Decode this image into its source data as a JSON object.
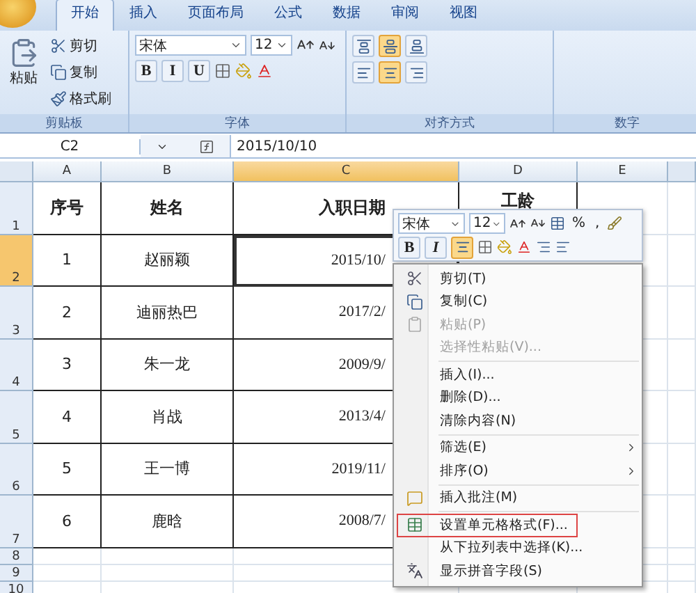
{
  "tabs": [
    {
      "label": "开始",
      "selected": true
    },
    {
      "label": "插入",
      "selected": false
    },
    {
      "label": "页面布局",
      "selected": false
    },
    {
      "label": "公式",
      "selected": false
    },
    {
      "label": "数据",
      "selected": false
    },
    {
      "label": "审阅",
      "selected": false
    },
    {
      "label": "视图",
      "selected": false
    }
  ],
  "ribbon": {
    "clipboard": {
      "label": "剪贴板",
      "paste": "粘贴",
      "items": [
        {
          "kind": "cut",
          "label": "剪切"
        },
        {
          "kind": "copy",
          "label": "复制"
        },
        {
          "kind": "painter",
          "label": "格式刷"
        }
      ]
    },
    "font": {
      "label": "字体",
      "font_name": "宋体",
      "font_size": "12",
      "styles": [
        "B",
        "I",
        "U"
      ]
    },
    "alignment": {
      "label": "对齐方式",
      "buttons": [
        {
          "kind": "top",
          "pressed": false
        },
        {
          "kind": "middle",
          "pressed": true
        },
        {
          "kind": "bottom",
          "pressed": false
        },
        {
          "kind": "left",
          "pressed": false
        },
        {
          "kind": "center",
          "pressed": true
        },
        {
          "kind": "right",
          "pressed": false
        }
      ]
    },
    "number": {
      "label": "数字"
    }
  },
  "formula_bar": {
    "name_box": "C2",
    "value": "2015/10/10"
  },
  "columns": [
    {
      "label": "A",
      "selected": false
    },
    {
      "label": "B",
      "selected": false
    },
    {
      "label": "C",
      "selected": true
    },
    {
      "label": "D",
      "selected": false
    },
    {
      "label": "E",
      "selected": false
    }
  ],
  "rows": [
    {
      "header": "1",
      "selected": false,
      "cells": [
        {
          "text": "序号",
          "active": false
        },
        {
          "text": "姓名",
          "active": false
        },
        {
          "text": "入职日期",
          "active": false
        },
        {
          "text": "工龄",
          "active": false
        }
      ]
    },
    {
      "header": "2",
      "selected": true,
      "cells": [
        {
          "text": "1",
          "active": false
        },
        {
          "text": "赵丽颖",
          "active": false
        },
        {
          "text": "2015/10/",
          "active": true
        }
      ]
    },
    {
      "header": "3",
      "selected": false,
      "cells": [
        {
          "text": "2",
          "active": false
        },
        {
          "text": "迪丽热巴",
          "active": false
        },
        {
          "text": "2017/2/",
          "active": false
        }
      ]
    },
    {
      "header": "4",
      "selected": false,
      "cells": [
        {
          "text": "3",
          "active": false
        },
        {
          "text": "朱一龙",
          "active": false
        },
        {
          "text": "2009/9/",
          "active": false
        }
      ]
    },
    {
      "header": "5",
      "selected": false,
      "cells": [
        {
          "text": "4",
          "active": false
        },
        {
          "text": "肖战",
          "active": false
        },
        {
          "text": "2013/4/",
          "active": false
        }
      ]
    },
    {
      "header": "6",
      "selected": false,
      "cells": [
        {
          "text": "5",
          "active": false
        },
        {
          "text": "王一博",
          "active": false
        },
        {
          "text": "2019/11/",
          "active": false
        }
      ]
    },
    {
      "header": "7",
      "selected": false,
      "cells": [
        {
          "text": "6",
          "active": false
        },
        {
          "text": "鹿晗",
          "active": false
        },
        {
          "text": "2008/7/",
          "active": false
        }
      ]
    },
    {
      "header": "8",
      "selected": false,
      "cells": []
    },
    {
      "header": "9",
      "selected": false,
      "cells": []
    },
    {
      "header": "10",
      "selected": false,
      "cells": []
    }
  ],
  "mini_toolbar": {
    "font_name": "宋体",
    "font_size": "12",
    "percent": "%",
    "comma": ",",
    "bold": "B",
    "italic": "I",
    "center_pressed": true
  },
  "context_menu": [
    {
      "kind": "cut",
      "label": "剪切(T)",
      "disabled": false,
      "submenu": false,
      "highlighted": false
    },
    {
      "kind": "copy",
      "label": "复制(C)",
      "disabled": false,
      "submenu": false,
      "highlighted": false
    },
    {
      "kind": "paste",
      "label": "粘贴(P)",
      "disabled": true,
      "submenu": false,
      "highlighted": false
    },
    {
      "kind": "plain",
      "label": "选择性粘贴(V)...",
      "disabled": true,
      "submenu": false,
      "highlighted": false
    },
    {
      "kind": "separator"
    },
    {
      "kind": "plain",
      "label": "插入(I)...",
      "disabled": false,
      "submenu": false,
      "highlighted": false
    },
    {
      "kind": "plain",
      "label": "删除(D)...",
      "disabled": false,
      "submenu": false,
      "highlighted": false
    },
    {
      "kind": "plain",
      "label": "清除内容(N)",
      "disabled": false,
      "submenu": false,
      "highlighted": false
    },
    {
      "kind": "separator"
    },
    {
      "kind": "plain",
      "label": "筛选(E)",
      "disabled": false,
      "submenu": true,
      "highlighted": false
    },
    {
      "kind": "plain",
      "label": "排序(O)",
      "disabled": false,
      "submenu": true,
      "highlighted": false
    },
    {
      "kind": "separator"
    },
    {
      "kind": "comment",
      "label": "插入批注(M)",
      "disabled": false,
      "submenu": false,
      "highlighted": false
    },
    {
      "kind": "separator"
    },
    {
      "kind": "format",
      "label": "设置单元格格式(F)...",
      "disabled": false,
      "submenu": false,
      "highlighted": true
    },
    {
      "kind": "plain",
      "label": "从下拉列表中选择(K)...",
      "disabled": false,
      "submenu": false,
      "highlighted": false
    },
    {
      "kind": "pinyin",
      "label": "显示拼音字段(S)",
      "disabled": false,
      "submenu": false,
      "highlighted": false
    }
  ]
}
